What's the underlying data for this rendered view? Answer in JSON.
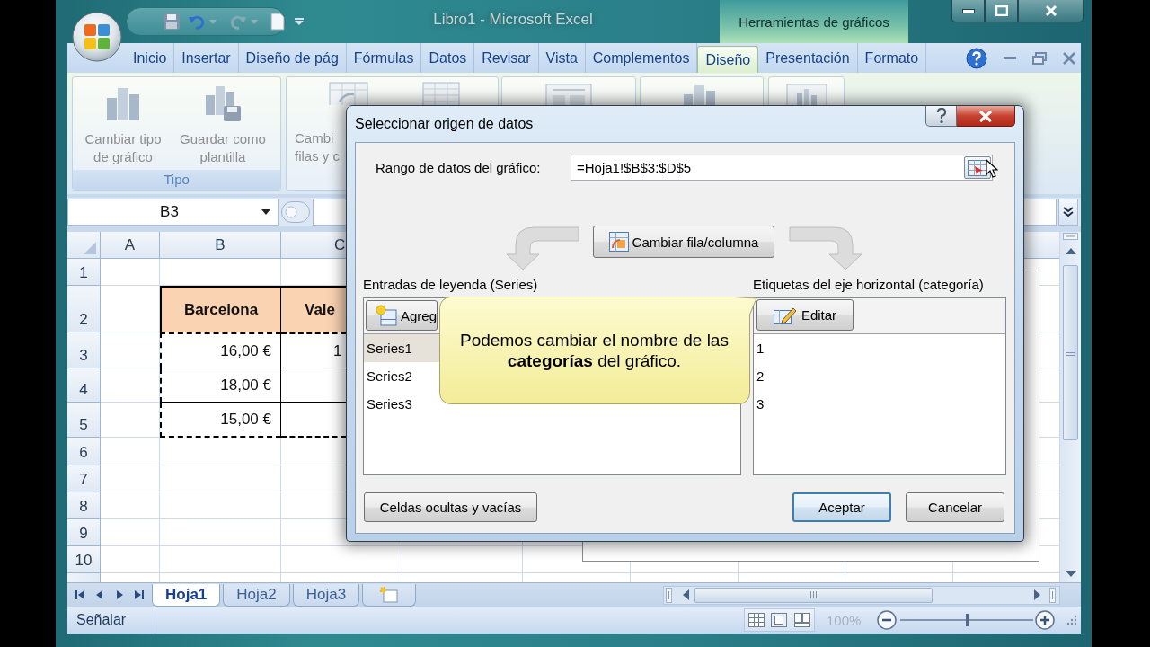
{
  "window": {
    "title": "Libro1 - Microsoft Excel",
    "context_title": "Herramientas de gráficos"
  },
  "ribbon": {
    "tabs": [
      {
        "label": "Inicio",
        "selected": false
      },
      {
        "label": "Insertar",
        "selected": false
      },
      {
        "label": "Diseño de pág",
        "selected": false
      },
      {
        "label": "Fórmulas",
        "selected": false
      },
      {
        "label": "Datos",
        "selected": false
      },
      {
        "label": "Revisar",
        "selected": false
      },
      {
        "label": "Vista",
        "selected": false
      },
      {
        "label": "Complementos",
        "selected": false
      },
      {
        "label": "Diseño",
        "selected": true
      },
      {
        "label": "Presentación",
        "selected": false
      },
      {
        "label": "Formato",
        "selected": false
      }
    ],
    "groups": [
      {
        "label": "Tipo",
        "buttons": [
          {
            "lines": [
              "Cambiar tipo",
              "de gráfico"
            ],
            "disabled": true
          },
          {
            "lines": [
              "Guardar como",
              "plantilla"
            ],
            "disabled": true
          }
        ]
      },
      {
        "buttons": [
          {
            "lines": [
              "Cambi",
              "filas y c"
            ],
            "disabled": true
          }
        ]
      }
    ]
  },
  "formula_bar": {
    "name_box": "B3"
  },
  "sheet": {
    "column_headers": [
      "A",
      "B",
      "C"
    ],
    "row_headers": [
      "1",
      "2",
      "3",
      "4",
      "5",
      "6",
      "7",
      "8",
      "9",
      "10"
    ],
    "table": {
      "header": [
        "Barcelona",
        "Vale"
      ],
      "rows": [
        [
          "16,00 €",
          "1"
        ],
        [
          "18,00 €"
        ],
        [
          "15,00 €"
        ]
      ]
    }
  },
  "sheet_tabs": [
    {
      "label": "Hoja1",
      "selected": true
    },
    {
      "label": "Hoja2",
      "selected": false
    },
    {
      "label": "Hoja3",
      "selected": false
    }
  ],
  "status_bar": {
    "mode": "Señalar",
    "zoom": "100%",
    "zoom_slider": {
      "level": 0.5
    }
  },
  "dialog": {
    "title": "Seleccionar origen de datos",
    "range_label": "Rango de datos del gráfico:",
    "range_value": "=Hoja1!$B$3:$D$5",
    "switch_button": "Cambiar fila/columna",
    "series": {
      "label": "Entradas de leyenda (Series)",
      "add_button": "Agreg",
      "items": [
        {
          "label": "Series1",
          "selected": true
        },
        {
          "label": "Series2",
          "selected": false
        },
        {
          "label": "Series3",
          "selected": false
        }
      ]
    },
    "categories": {
      "label": "Etiquetas del eje horizontal (categoría)",
      "edit_button": "Editar",
      "items": [
        {
          "label": "1",
          "selected": false
        },
        {
          "label": "2",
          "selected": false
        },
        {
          "label": "3",
          "selected": false
        }
      ]
    },
    "hidden_cells_button": "Celdas ocultas y vacías",
    "buttons": [
      {
        "label": "Aceptar",
        "default": true
      },
      {
        "label": "Cancelar",
        "default": false
      }
    ]
  },
  "callout": {
    "text": "Podemos cambiar el nombre de las **categorías** del gráfico."
  }
}
